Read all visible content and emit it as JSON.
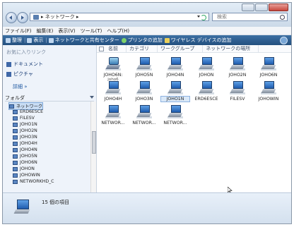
{
  "window": {
    "address_path": "▸ ネットワーク ▸",
    "search_placeholder": "検索"
  },
  "menu": [
    "ファイル(F)",
    "編集(E)",
    "表示(V)",
    "ツール(T)",
    "ヘルプ(H)"
  ],
  "commands": {
    "organize": "整理",
    "views": "表示",
    "network_center": "ネットワークと共有センター",
    "add_printer": "プリンタの追加",
    "add_wireless": "ワイヤレス デバイスの追加"
  },
  "sidebar": {
    "favorites_title": "お気に入りリンク",
    "favorites": [
      "ドキュメント",
      "ピクチャ"
    ],
    "more_label": "詳細 »",
    "folders_label": "フォルダ",
    "tree": [
      "ネットワーク",
      "ERD6ESCE",
      "FILESV",
      "JOHO1N",
      "JOHO2N",
      "JOHO3N",
      "JOHO4H",
      "JOHO4N",
      "JOHO5N",
      "JOHO6N",
      "JOHON",
      "JOHOWIN",
      "NETWORKHD_C"
    ]
  },
  "columns": [
    "名前",
    "カテゴリ",
    "ワークグループ",
    "ネットワークの場所"
  ],
  "items": [
    {
      "label": "JOHO6N:",
      "sub": "joho6",
      "kind": "media"
    },
    {
      "label": "JOHO5N",
      "sub": "",
      "kind": "pc"
    },
    {
      "label": "JOHO4N",
      "sub": "",
      "kind": "pc"
    },
    {
      "label": "JOHON",
      "sub": "",
      "kind": "pc"
    },
    {
      "label": "JOHO2N",
      "sub": "",
      "kind": "pc"
    },
    {
      "label": "JOHO6N",
      "sub": "",
      "kind": "pc"
    },
    {
      "label": "JOHO4H",
      "sub": "",
      "kind": "pc"
    },
    {
      "label": "JOHO3N",
      "sub": "",
      "kind": "pc"
    },
    {
      "label": "JOHO1N",
      "sub": "",
      "kind": "pc",
      "selected": true
    },
    {
      "label": "ERD6ESCE",
      "sub": "",
      "kind": "pc"
    },
    {
      "label": "FILESV",
      "sub": "",
      "kind": "pc"
    },
    {
      "label": "JOHOWIN",
      "sub": "",
      "kind": "pc"
    },
    {
      "label": "NETWOR...",
      "sub": "",
      "kind": "pc"
    },
    {
      "label": "NETWOR...",
      "sub": "",
      "kind": "pc"
    },
    {
      "label": "NETWOR...",
      "sub": "",
      "kind": "pc"
    }
  ],
  "status": {
    "count_text": "15 個の項目"
  }
}
